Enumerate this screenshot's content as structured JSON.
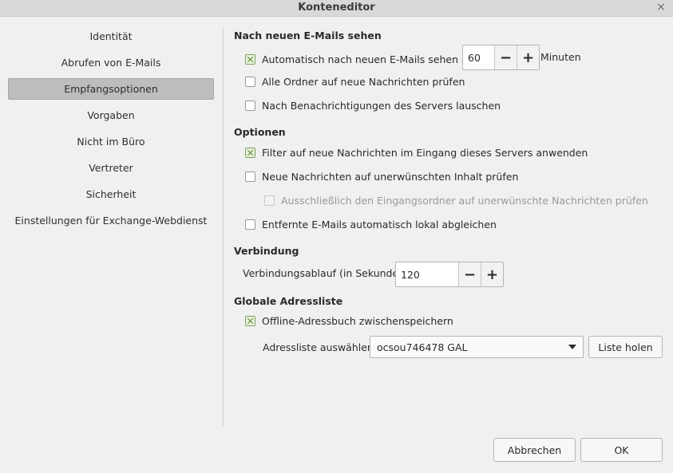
{
  "window": {
    "title": "Konteneditor"
  },
  "sidebar": {
    "items": [
      {
        "label": "Identität"
      },
      {
        "label": "Abrufen von E-Mails"
      },
      {
        "label": "Empfangsoptionen"
      },
      {
        "label": "Vorgaben"
      },
      {
        "label": "Nicht im Büro"
      },
      {
        "label": "Vertreter"
      },
      {
        "label": "Sicherheit"
      },
      {
        "label": "Einstellungen für Exchange-Webdienst"
      }
    ],
    "active": "Empfangsoptionen"
  },
  "sections": {
    "new_mail": {
      "title": "Nach neuen E-Mails sehen",
      "auto_check": {
        "label": "Automatisch nach neuen E-Mails sehen alle",
        "checked": true
      },
      "interval": {
        "value": "60",
        "unit": "Minuten"
      },
      "all_folders": {
        "label": "Alle Ordner auf neue Nachrichten prüfen",
        "checked": false
      },
      "server_notify": {
        "label": "Nach Benachrichtigungen des Servers lauschen",
        "checked": false
      }
    },
    "options": {
      "title": "Optionen",
      "filter_inbox": {
        "label": "Filter auf neue Nachrichten im Eingang dieses Servers anwenden",
        "checked": true
      },
      "junk_check": {
        "label": "Neue Nachrichten auf unerwünschten Inhalt prüfen",
        "checked": false
      },
      "junk_inbox_only": {
        "label": "Ausschließlich den Eingangsordner auf unerwünschte Nachrichten prüfen",
        "checked": false,
        "disabled": true
      },
      "sync_remote": {
        "label": "Entfernte E-Mails automatisch lokal abgleichen",
        "checked": false
      }
    },
    "connection": {
      "title": "Verbindung",
      "timeout_label": "Verbindungsablauf (in Sekunden)",
      "timeout_value": "120"
    },
    "gal": {
      "title": "Globale Adressliste",
      "cache_offline": {
        "label": "Offline-Adressbuch zwischenspeichern",
        "checked": true
      },
      "select_label": "Adressliste auswählen:",
      "select_value": "ocsou746478 GAL",
      "fetch_button": "Liste holen"
    }
  },
  "footer": {
    "cancel": "Abbrechen",
    "ok": "OK"
  },
  "icons": {
    "minus": "−",
    "plus": "+",
    "close": "×"
  }
}
